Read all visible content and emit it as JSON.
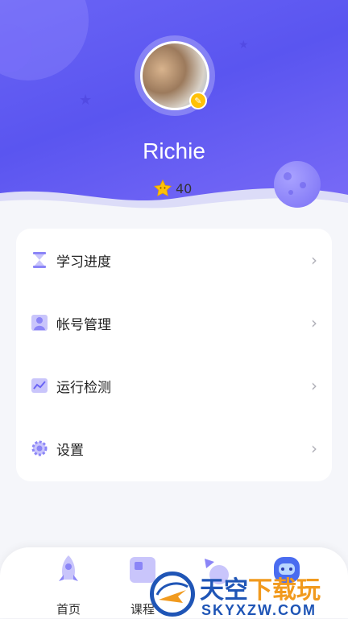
{
  "profile": {
    "username": "Richie",
    "stars": "40"
  },
  "menu": {
    "items": [
      {
        "label": "学习进度",
        "icon": "hourglass-icon"
      },
      {
        "label": "帐号管理",
        "icon": "account-icon"
      },
      {
        "label": "运行检测",
        "icon": "line-chart-icon"
      },
      {
        "label": "设置",
        "icon": "gear-icon"
      }
    ]
  },
  "tabbar": {
    "tabs": [
      {
        "label": "首页"
      },
      {
        "label": "课程"
      },
      {
        "label": ""
      },
      {
        "label": ""
      }
    ]
  },
  "watermark": {
    "brand_main": "天空",
    "brand_accent": "下载玩",
    "domain": "SKYXZW.COM"
  },
  "colors": {
    "header": "#5a55f0",
    "accent": "#8b85f7",
    "star": "#ffc107",
    "watermark_blue": "#1f55b6",
    "watermark_orange": "#f19a1e"
  }
}
